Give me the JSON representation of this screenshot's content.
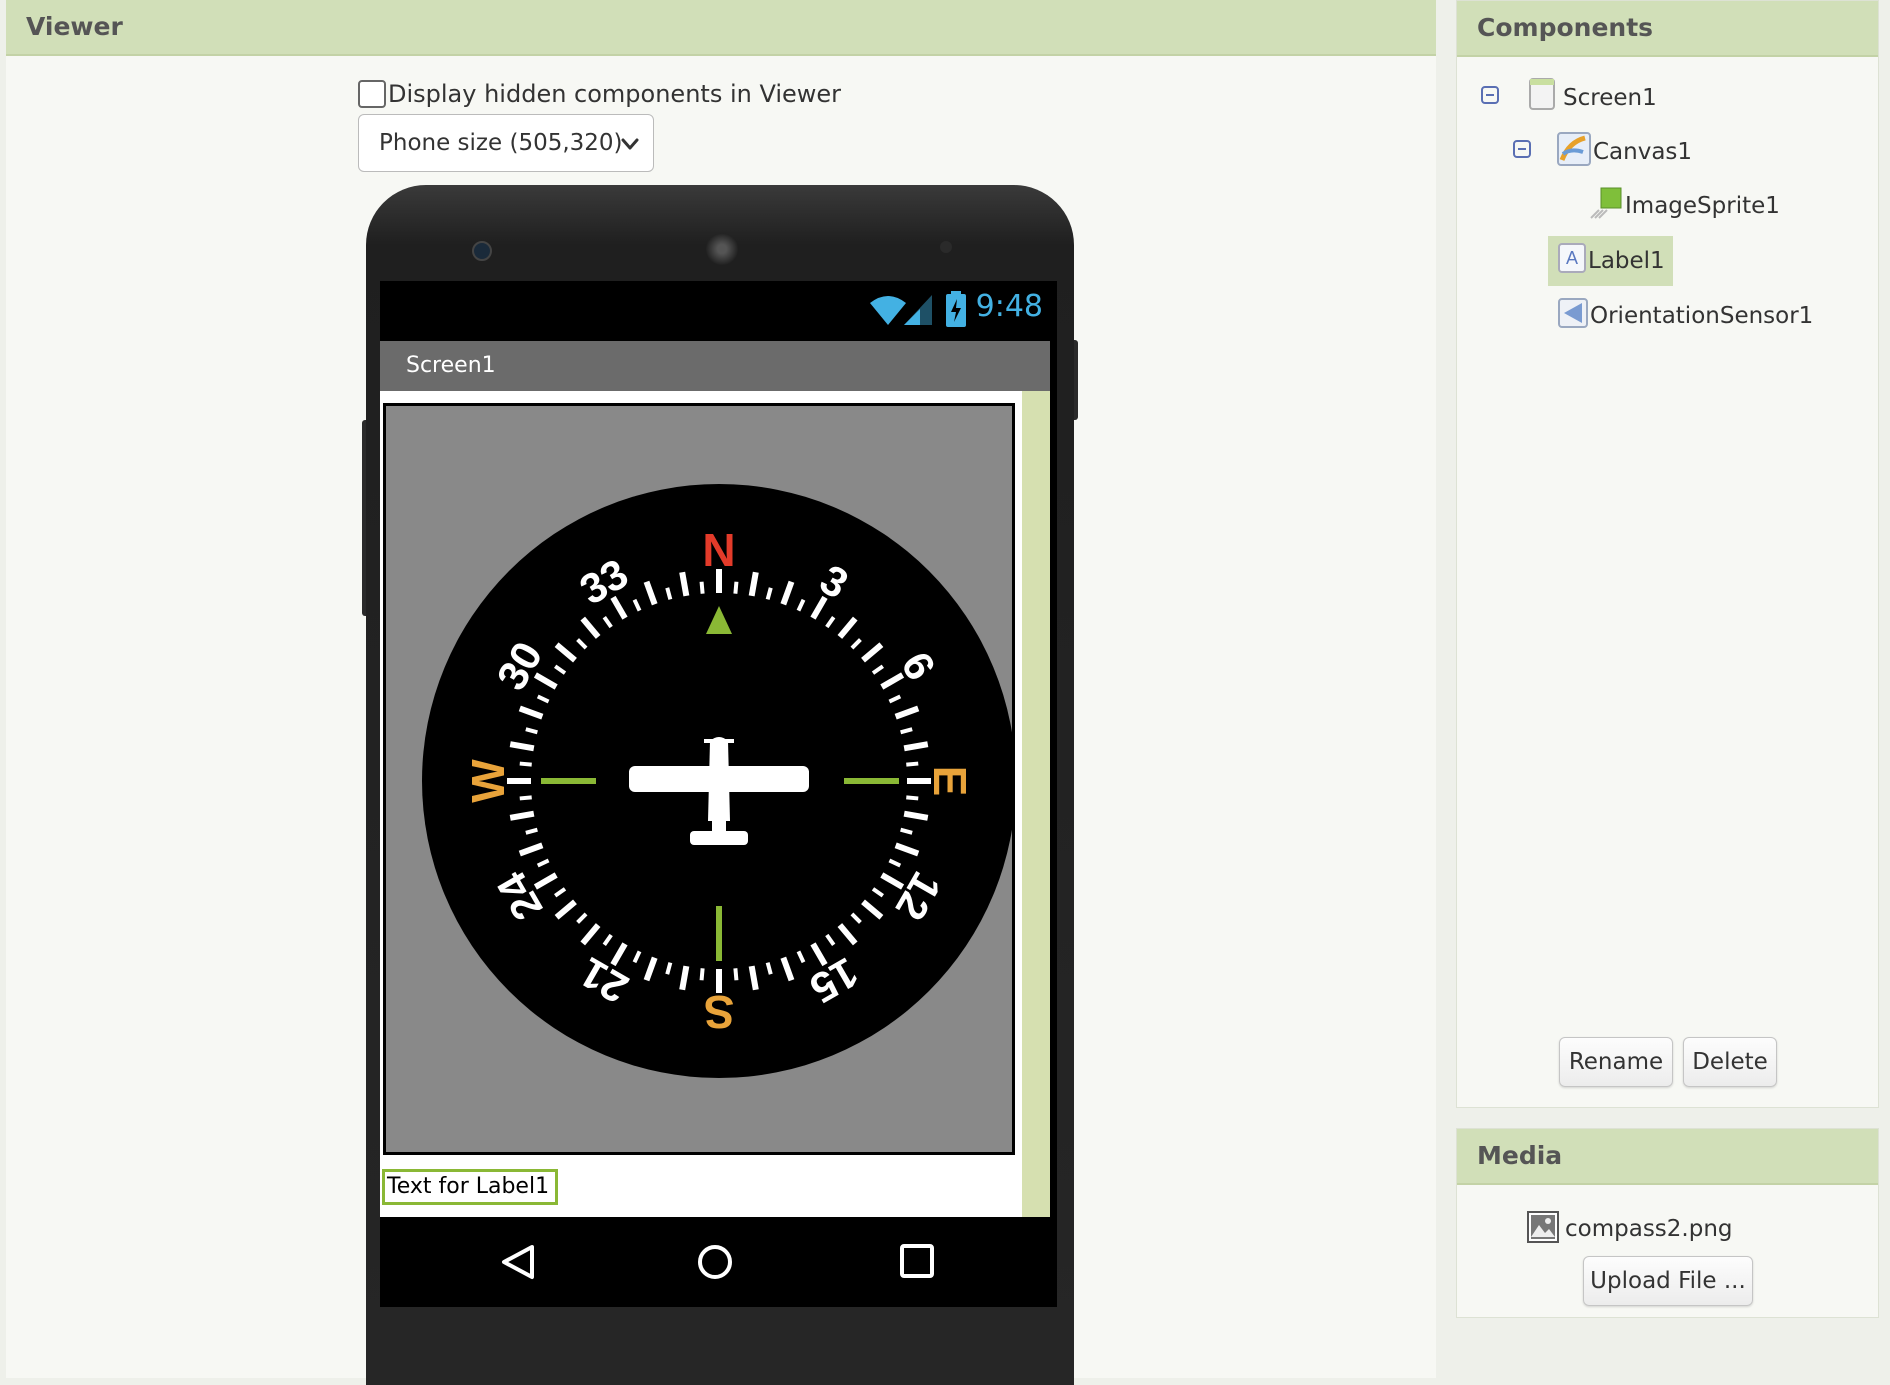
{
  "viewer": {
    "title": "Viewer",
    "hidden_components_label": "Display hidden components in Viewer",
    "hidden_components_checked": false,
    "size_select": "Phone size (505,320)",
    "phone": {
      "status_time": "9:48",
      "screen_title": "Screen1",
      "label_text": "Text for Label1",
      "compass": {
        "north": "N",
        "east": "E",
        "south": "S",
        "west": "W",
        "n3": "3",
        "n6": "6",
        "n12": "12",
        "n15": "15",
        "n21": "21",
        "n24": "24",
        "n30": "30",
        "n33": "33"
      }
    }
  },
  "components": {
    "title": "Components",
    "items": [
      {
        "label": "Screen1",
        "icon": "screen-icon"
      },
      {
        "label": "Canvas1",
        "icon": "canvas-icon"
      },
      {
        "label": "ImageSprite1",
        "icon": "image-sprite-icon"
      },
      {
        "label": "Label1",
        "icon": "label-icon",
        "selected": true
      },
      {
        "label": "OrientationSensor1",
        "icon": "orientation-sensor-icon"
      }
    ],
    "rename_label": "Rename",
    "delete_label": "Delete"
  },
  "media": {
    "title": "Media",
    "file_name": "compass2.png",
    "upload_label": "Upload File ..."
  },
  "colors": {
    "header": "#d1dfb8",
    "selection": "#d1dfb8",
    "label_border": "#8ab835",
    "status_time": "#43b1e3",
    "north": "#e33b2a",
    "cardinal": "#e8a33a",
    "green_marker": "#8ab835"
  }
}
